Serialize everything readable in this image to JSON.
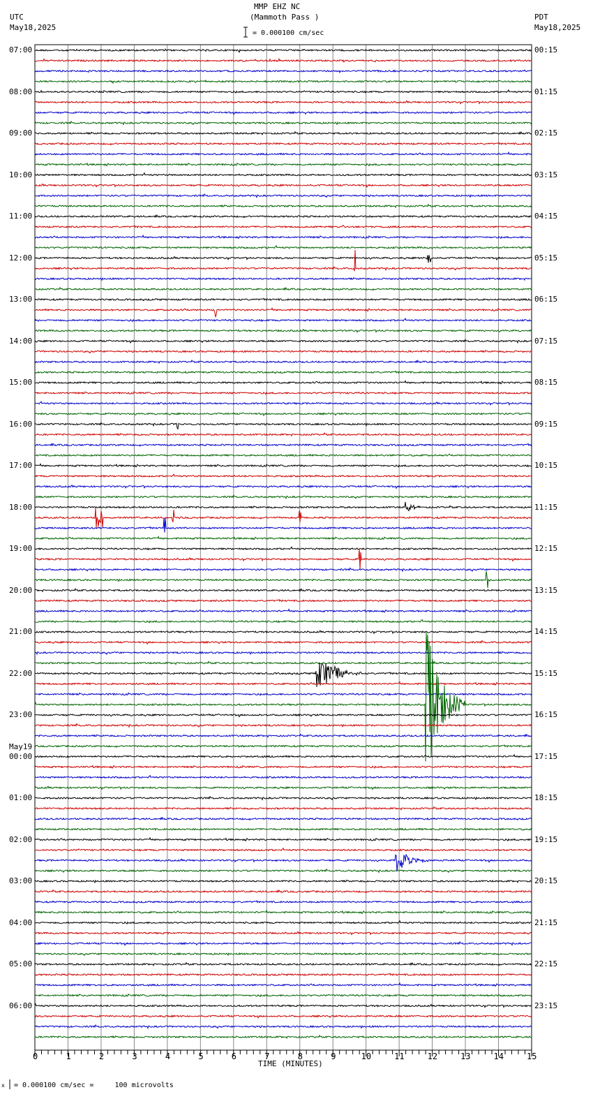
{
  "header": {
    "station": "MMP EHZ NC",
    "site": "(Mammoth Pass )",
    "left_tz": "UTC",
    "left_date": "May18,2025",
    "right_tz": "PDT",
    "right_date": "May18,2025",
    "scale": "= 0.000100 cm/sec"
  },
  "footer": {
    "scale": "= 0.000100 cm/sec =     100 microvolts",
    "prefix": "x"
  },
  "chart_data": {
    "type": "line",
    "title": "MMP EHZ NC (Mammoth Pass )",
    "xlabel": "TIME (MINUTES)",
    "xlim": [
      0,
      15
    ],
    "x_ticks": [
      "0",
      "1",
      "2",
      "3",
      "4",
      "5",
      "6",
      "7",
      "8",
      "9",
      "10",
      "11",
      "12",
      "13",
      "14",
      "15"
    ],
    "traces_per_hour": 4,
    "trace_colors": [
      "#000000",
      "#d00000",
      "#0000cc",
      "#006400"
    ],
    "utc_labels": [
      "07:00",
      "08:00",
      "09:00",
      "10:00",
      "11:00",
      "12:00",
      "13:00",
      "14:00",
      "15:00",
      "16:00",
      "17:00",
      "18:00",
      "19:00",
      "20:00",
      "21:00",
      "22:00",
      "23:00",
      "00:00",
      "01:00",
      "02:00",
      "03:00",
      "04:00",
      "05:00",
      "06:00"
    ],
    "utc_date_change": {
      "label": "May19",
      "before_hour_index": 17
    },
    "pdt_labels": [
      "00:15",
      "01:15",
      "02:15",
      "03:15",
      "04:15",
      "05:15",
      "06:15",
      "07:15",
      "08:15",
      "09:15",
      "10:15",
      "11:15",
      "12:15",
      "13:15",
      "14:15",
      "15:15",
      "16:15",
      "17:15",
      "18:15",
      "19:15",
      "20:15",
      "21:15",
      "22:15",
      "23:15"
    ],
    "events": [
      {
        "trace": 17,
        "minute": 9.3,
        "amp": 8,
        "dur": 0.05
      },
      {
        "trace": 20,
        "minute": 11.85,
        "amp": 7,
        "dur": 0.1
      },
      {
        "trace": 21,
        "minute": 9.65,
        "amp": 26,
        "dur": 0.04
      },
      {
        "trace": 25,
        "minute": 5.45,
        "amp": 12,
        "dur": 0.04
      },
      {
        "trace": 36,
        "minute": 4.3,
        "amp": 7,
        "dur": 0.05
      },
      {
        "trace": 44,
        "minute": 11.2,
        "amp": 12,
        "dur": 0.5
      },
      {
        "trace": 45,
        "minute": 1.85,
        "amp": 15,
        "dur": 0.2
      },
      {
        "trace": 45,
        "minute": 8.0,
        "amp": 14,
        "dur": 0.04
      },
      {
        "trace": 45,
        "minute": 4.15,
        "amp": 12,
        "dur": 0.05
      },
      {
        "trace": 46,
        "minute": 3.9,
        "amp": 14,
        "dur": 0.04
      },
      {
        "trace": 49,
        "minute": 9.8,
        "amp": 20,
        "dur": 0.04
      },
      {
        "trace": 51,
        "minute": 13.65,
        "amp": 15,
        "dur": 0.04
      },
      {
        "trace": 60,
        "minute": 8.5,
        "amp": 30,
        "dur": 1.4
      },
      {
        "trace": 63,
        "minute": 11.8,
        "amp": 120,
        "dur": 1.2
      },
      {
        "trace": 78,
        "minute": 10.9,
        "amp": 20,
        "dur": 1.0
      }
    ]
  }
}
